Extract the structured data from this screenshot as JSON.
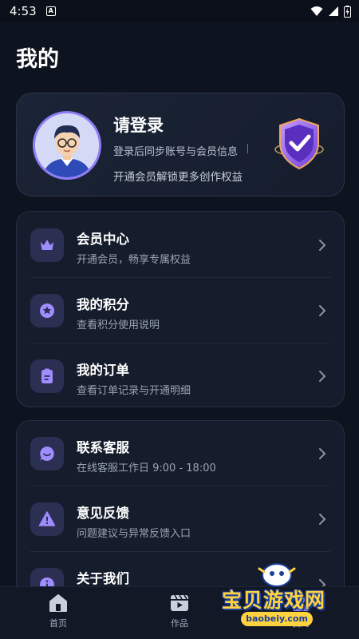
{
  "status_bar": {
    "time": "4:53"
  },
  "page_title": "我的",
  "profile": {
    "title": "请登录",
    "subtitle": "登录后同步账号与会员信息",
    "subtitle2": "开通会员解锁更多创作权益"
  },
  "menu_group_1": [
    {
      "title": "会员中心",
      "desc": "开通会员，畅享专属权益",
      "icon": "crown-icon"
    },
    {
      "title": "我的积分",
      "desc": "查看积分使用说明",
      "icon": "star-icon"
    },
    {
      "title": "我的订单",
      "desc": "查看订单记录与开通明细",
      "icon": "order-icon"
    }
  ],
  "menu_group_2": [
    {
      "title": "联系客服",
      "desc": "在线客服工作日 9:00 - 18:00",
      "icon": "chat-icon"
    },
    {
      "title": "意见反馈",
      "desc": "问题建议与异常反馈入口",
      "icon": "warning-icon"
    },
    {
      "title": "关于我们",
      "desc": "",
      "icon": "info-icon"
    }
  ],
  "bottom_nav": [
    {
      "label": "首页",
      "icon": "home-icon"
    },
    {
      "label": "作品",
      "icon": "video-icon"
    },
    {
      "label": "我的",
      "icon": "profile-icon"
    }
  ],
  "watermark": {
    "text": "宝贝游戏网",
    "url": "baobeiy.com"
  },
  "colors": {
    "background": "#0e1320",
    "card": "#151c2b",
    "accent": "#8f7cf6",
    "icon_bg": "#2b2f52"
  }
}
